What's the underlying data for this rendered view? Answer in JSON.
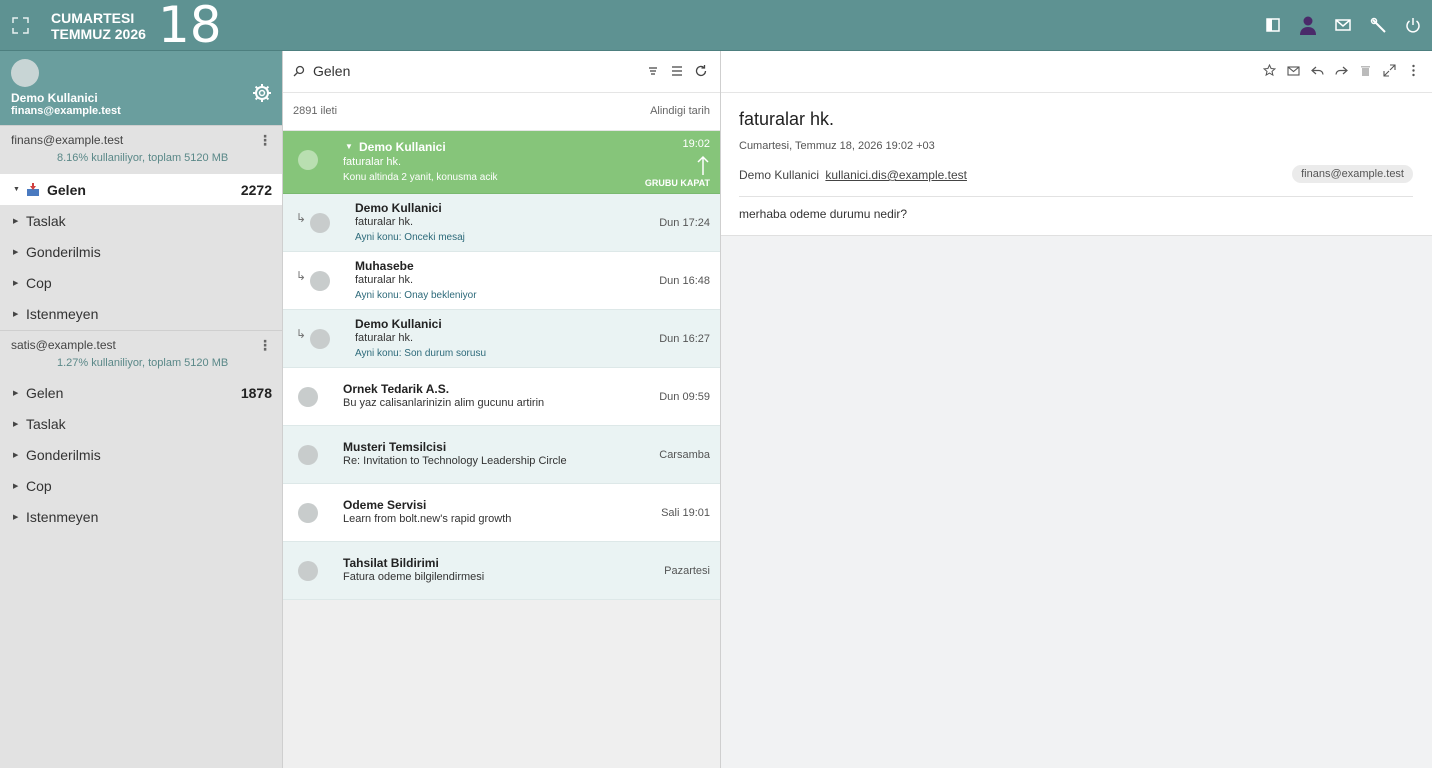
{
  "topbar": {
    "day_name": "CUMARTESI",
    "month_year": "TEMMUZ 2026",
    "day_number": "18",
    "icons": [
      "expand-icon",
      "layout-icon",
      "user-icon",
      "mail-icon",
      "wrench-icon",
      "power-icon"
    ],
    "accent": "#5e9292"
  },
  "user": {
    "name": "Demo Kullanici",
    "email": "finans@example.test"
  },
  "accounts": [
    {
      "email": "finans@example.test",
      "usage": "8.16% kullaniliyor, toplam 5120 MB",
      "folders": [
        {
          "label": "Gelen",
          "count": "2272",
          "active": true
        },
        {
          "label": "Taslak",
          "count": ""
        },
        {
          "label": "Gonderilmis",
          "count": ""
        },
        {
          "label": "Cop",
          "count": ""
        },
        {
          "label": "Istenmeyen",
          "count": ""
        }
      ]
    },
    {
      "email": "satis@example.test",
      "usage": "1.27% kullaniliyor, toplam 5120 MB",
      "folders": [
        {
          "label": "Gelen",
          "count": "1878"
        },
        {
          "label": "Taslak",
          "count": ""
        },
        {
          "label": "Gonderilmis",
          "count": ""
        },
        {
          "label": "Cop",
          "count": ""
        },
        {
          "label": "Istenmeyen",
          "count": ""
        }
      ]
    }
  ],
  "list": {
    "folder": "Gelen",
    "count": "2891 ileti",
    "sort": "Alindigi tarih",
    "selected": {
      "from": "Demo Kullanici",
      "subject": "faturalar hk.",
      "note": "Konu altinda 2 yanit, konusma acik",
      "time": "19:02",
      "collapse_label": "GRUBU KAPAT"
    },
    "messages": [
      {
        "from": "Demo Kullanici",
        "subject": "faturalar hk.",
        "note": "Ayni konu: Onceki mesaj",
        "time": "Dun 17:24"
      },
      {
        "from": "Muhasebe",
        "subject": "faturalar hk.",
        "note": "Ayni konu: Onay bekleniyor",
        "time": "Dun 16:48"
      },
      {
        "from": "Demo Kullanici",
        "subject": "faturalar hk.",
        "note": "Ayni konu: Son durum sorusu",
        "time": "Dun 16:27"
      },
      {
        "from": "Ornek Tedarik A.S.",
        "subject": "Bu yaz calisanlarinizin alim gucunu artirin",
        "time": "Dun 09:59"
      },
      {
        "from": "Musteri Temsilcisi",
        "subject": "Re: Invitation to Technology Leadership Circle",
        "time": "Carsamba"
      },
      {
        "from": "Odeme Servisi",
        "subject": "Learn from bolt.new's rapid growth",
        "time": "Sali 19:01"
      },
      {
        "from": "Tahsilat Bildirimi",
        "subject": "Fatura odeme bilgilendirmesi",
        "time": "Pazartesi"
      }
    ]
  },
  "reader": {
    "subject": "faturalar hk.",
    "date": "Cumartesi, Temmuz 18, 2026 19:02 +03",
    "from_name": "Demo Kullanici",
    "from_email": "kullanici.dis@example.test",
    "to": "finans@example.test",
    "body": "merhaba odeme durumu nedir?",
    "tools": [
      "star-icon",
      "envelope-icon",
      "reply-icon",
      "forward-icon",
      "trash-icon",
      "fullscreen-icon",
      "more-icon"
    ]
  },
  "colors": {
    "selected_row": "#86c57a",
    "sidebar": "#e2e2e2"
  }
}
